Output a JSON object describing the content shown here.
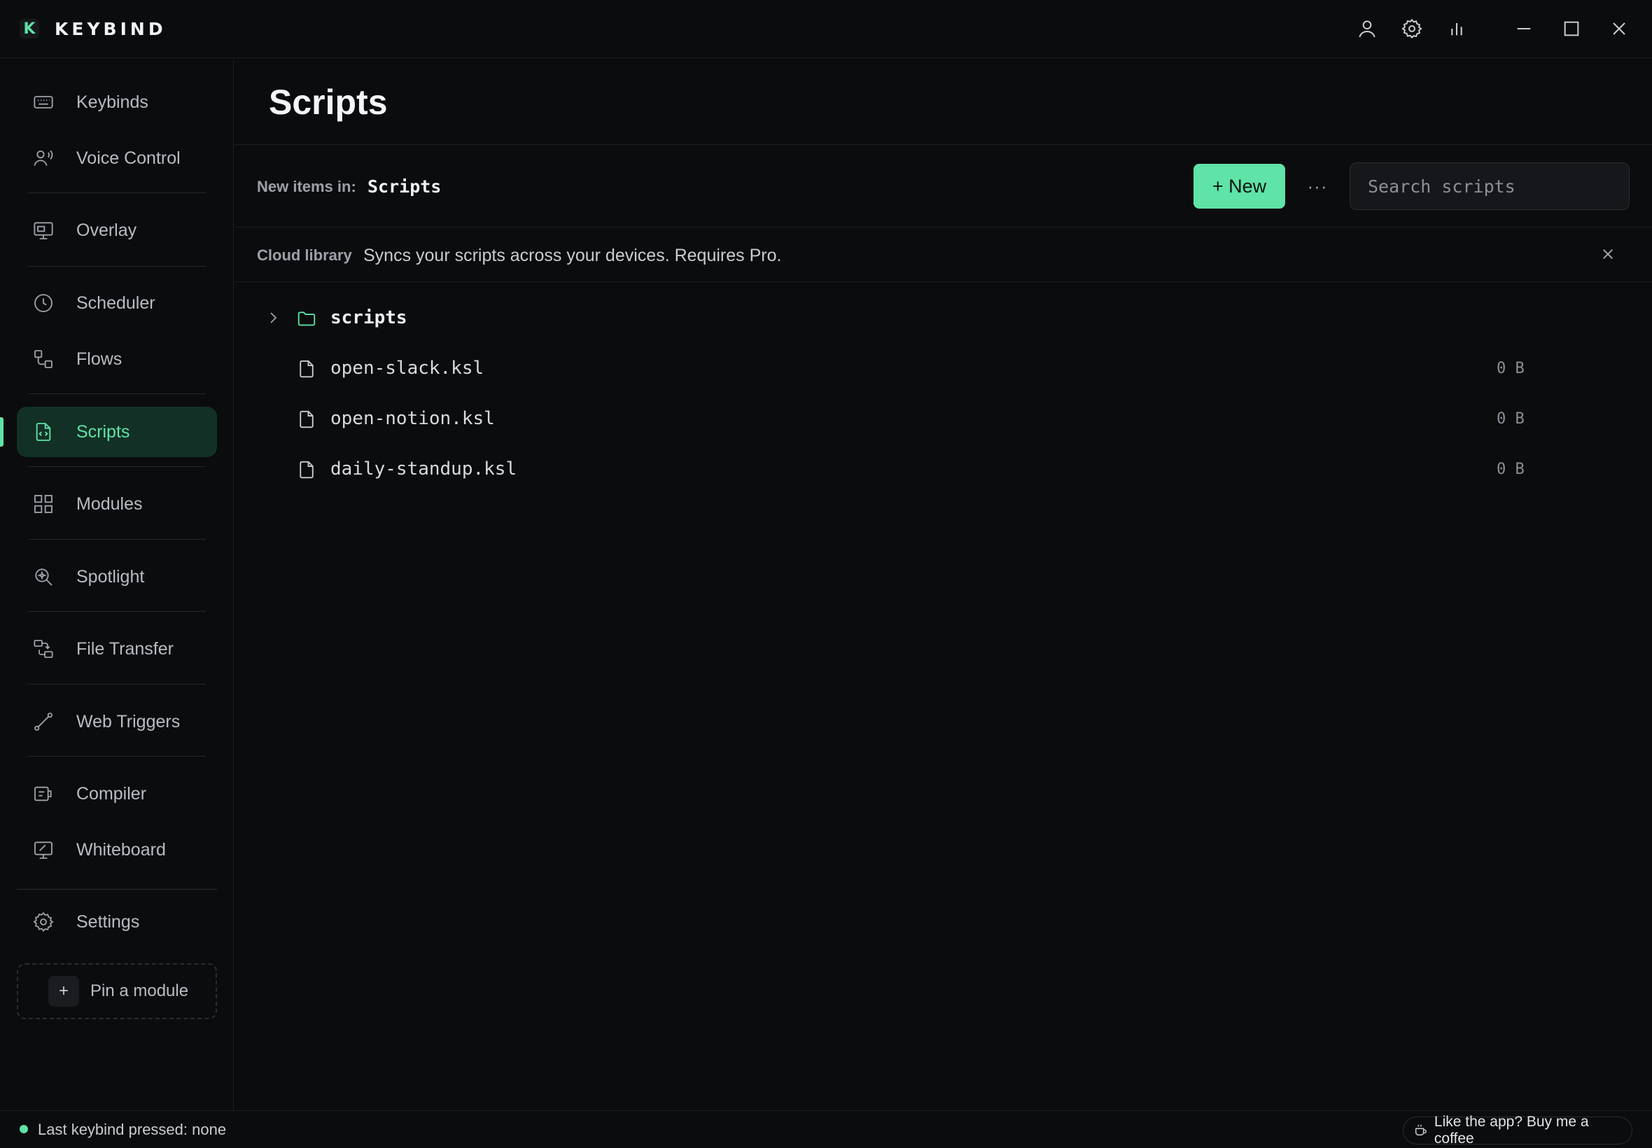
{
  "app": {
    "logo_letter": "K",
    "name": "KEYBIND"
  },
  "window_controls": {
    "icons": [
      "user-icon",
      "gear-icon",
      "bar-chart-icon",
      "minimize-icon",
      "maximize-icon",
      "close-icon"
    ]
  },
  "sidebar": {
    "items": [
      {
        "label": "Keybinds",
        "icon": "keyboard-icon"
      },
      {
        "label": "Voice Control",
        "icon": "voice-icon"
      },
      {
        "label": "Overlay",
        "icon": "monitor-icon"
      },
      {
        "label": "Scheduler",
        "icon": "clock-icon"
      },
      {
        "label": "Flows",
        "icon": "flows-icon"
      },
      {
        "label": "Scripts",
        "icon": "script-file-icon",
        "active": true
      },
      {
        "label": "Modules",
        "icon": "grid-icon"
      },
      {
        "label": "Spotlight",
        "icon": "spotlight-search-icon"
      },
      {
        "label": "File Transfer",
        "icon": "file-transfer-icon"
      },
      {
        "label": "Web Triggers",
        "icon": "web-trigger-icon"
      },
      {
        "label": "Compiler",
        "icon": "compiler-icon"
      },
      {
        "label": "Whiteboard",
        "icon": "whiteboard-icon"
      },
      {
        "label": "Settings",
        "icon": "gear-icon"
      }
    ],
    "pin_module": {
      "plus": "+",
      "label": "Pin a module"
    }
  },
  "main": {
    "title": "Scripts",
    "toolbar": {
      "new_items_label": "New items in:",
      "new_items_folder": "Scripts",
      "new_button": "+ New",
      "more_button": "···",
      "search_placeholder": "Search scripts"
    },
    "banner": {
      "title": "Cloud library",
      "text": "Syncs your scripts across your devices. Requires Pro."
    },
    "tree": [
      {
        "type": "folder",
        "name": "scripts",
        "size": ""
      },
      {
        "type": "file",
        "name": "open-slack.ksl",
        "size": "0 B"
      },
      {
        "type": "file",
        "name": "open-notion.ksl",
        "size": "0 B"
      },
      {
        "type": "file",
        "name": "daily-standup.ksl",
        "size": "0 B"
      }
    ]
  },
  "statusbar": {
    "text": "Last keybind pressed: none",
    "coffee": "Like the app? Buy me a coffee"
  },
  "colors": {
    "accent": "#5fe3a6",
    "background": "#0b0c0e",
    "active_bg": "#133026"
  }
}
